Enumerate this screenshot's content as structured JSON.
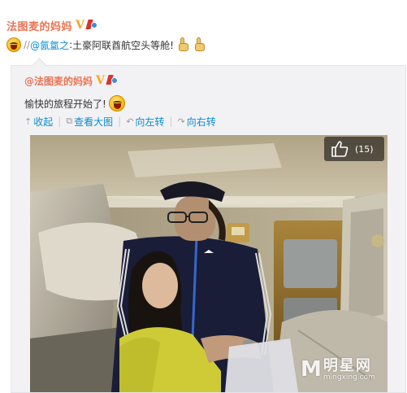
{
  "post": {
    "author": "法图麦的妈妈",
    "verified_badge": "V",
    "separator": "//",
    "mention": "@氤氲之",
    "colon": ":",
    "status_text": "土豪阿联酋航空头等舱!",
    "icons": [
      "laugh-emoji",
      "thumbs-up-emoji",
      "thumbs-up-emoji"
    ]
  },
  "repost": {
    "author": "@法图麦的妈妈",
    "verified_badge": "V",
    "text": "愉快的旅程开始了!",
    "actions": {
      "collapse": "收起",
      "view_large": "查看大图",
      "rotate_left": "向左转",
      "rotate_right": "向右转"
    },
    "action_icons": [
      "up-arrow-icon",
      "enlarge-icon",
      "rotate-left-icon",
      "rotate-right-icon"
    ],
    "photo": {
      "description_icon": "photo-first-class-cabin",
      "like_count": "(15)"
    }
  },
  "watermark": {
    "logo": "M",
    "name": "明星网",
    "url": "mingxing.com"
  },
  "colors": {
    "author": "#eb7350",
    "link": "#0a8cd2",
    "repost_bg": "#f2f2f5",
    "verified": "#f5a623"
  }
}
